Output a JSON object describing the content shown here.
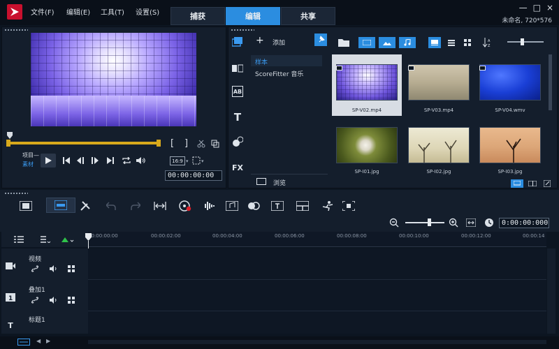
{
  "menu": [
    "文件(F)",
    "编辑(E)",
    "工具(T)",
    "设置(S)"
  ],
  "tabs": [
    {
      "label": "捕获",
      "active": false
    },
    {
      "label": "编辑",
      "active": true
    },
    {
      "label": "共享",
      "active": false
    }
  ],
  "window": {
    "project": "未命名, 720*576",
    "controls": [
      "—",
      "□",
      "×"
    ]
  },
  "player": {
    "mode_top": "项目—",
    "mode_bottom": "素材",
    "aspect": "16:9",
    "timecode": "00:00:00:00",
    "mark_in": "[",
    "mark_out": "]"
  },
  "library": {
    "add_label": "添加",
    "folders": [
      "样本",
      "ScoreFitter 音乐"
    ],
    "browse_label": "浏览",
    "side_icons": [
      "media-icon",
      "transition-icon",
      "title-ab-icon",
      "text-icon",
      "effects-icon",
      "fx-icon"
    ],
    "fx_label": "FX",
    "ab_label": "AB",
    "items": [
      {
        "name": "SP-V02.mp4",
        "selected": true
      },
      {
        "name": "SP-V03.mp4",
        "selected": false
      },
      {
        "name": "SP-V04.wmv",
        "selected": false
      },
      {
        "name": "SP-I01.jpg",
        "selected": false
      },
      {
        "name": "SP-I02.jpg",
        "selected": false
      },
      {
        "name": "SP-I03.jpg",
        "selected": false
      }
    ]
  },
  "timeline": {
    "timecode": "0:00:00:000",
    "ruler": [
      "00:00:00:00",
      "00:00:02:00",
      "00:00:04:00",
      "00:00:06:00",
      "00:00:08:00",
      "00:00:10:00",
      "00:00:12:00",
      "00:00:14"
    ],
    "tracks": [
      {
        "name": "视频"
      },
      {
        "name": "叠加1"
      },
      {
        "name": "标题1"
      }
    ]
  },
  "colors": {
    "accent": "#2b8de0",
    "scrub": "#d8a91c",
    "logo": "#c8102e"
  }
}
